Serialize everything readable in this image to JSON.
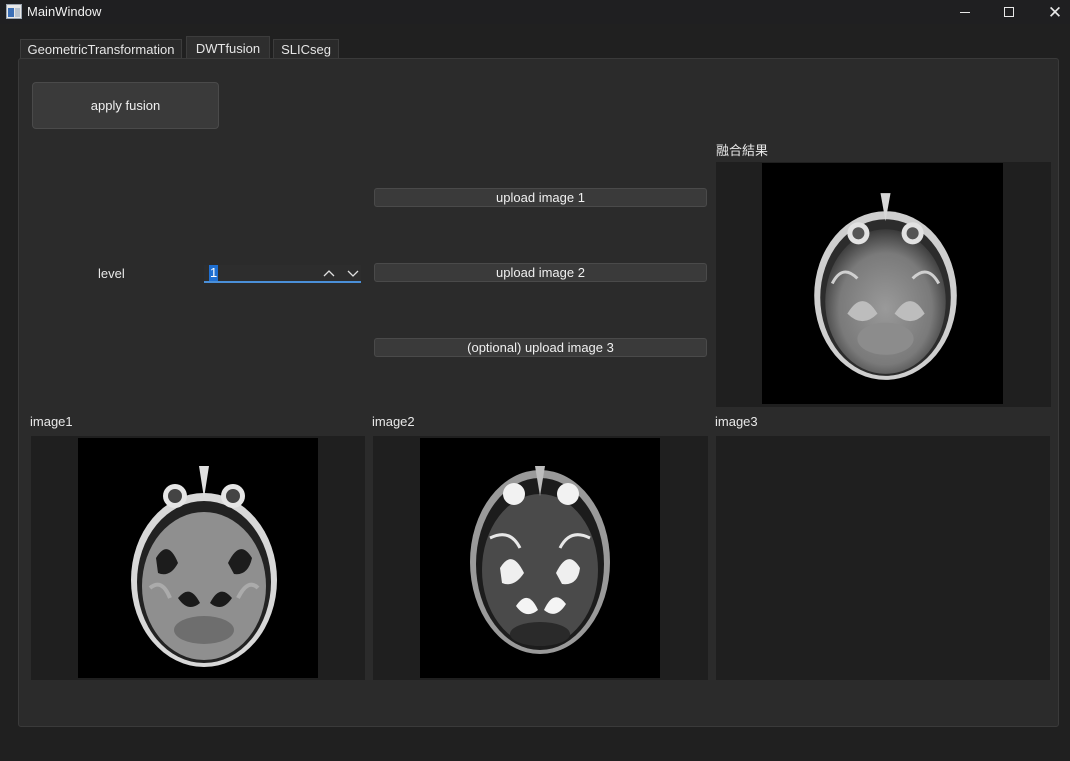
{
  "window": {
    "title": "MainWindow",
    "icon": "app-window-icon",
    "controls": [
      "minimize-icon",
      "maximize-icon",
      "close-icon"
    ],
    "close_glyph": "✕"
  },
  "tabs": [
    {
      "label": "GeometricTransformation",
      "active": false
    },
    {
      "label": "DWTfusion",
      "active": true
    },
    {
      "label": "SLICseg",
      "active": false
    }
  ],
  "fusion": {
    "apply_label": "apply fusion",
    "level_label": "level",
    "level_value": "1",
    "upload1_label": "upload image 1",
    "upload2_label": "upload image 2",
    "upload3_label": "(optional) upload image 3",
    "result_label": "融合結果",
    "image1_label": "image1",
    "image2_label": "image2",
    "image3_label": "image3"
  },
  "colors": {
    "background": "#202020",
    "panel": "#2b2b2b",
    "accent": "#1f6fd1",
    "focus_line": "#4a8fd8"
  }
}
